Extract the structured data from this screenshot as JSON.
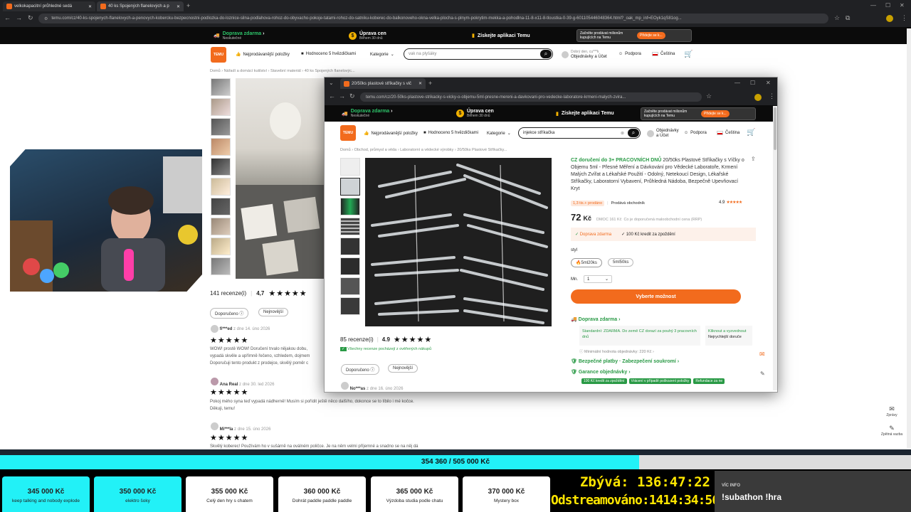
{
  "browser": {
    "tabs": [
      {
        "label": "velkokapacitní průhledné sedá"
      },
      {
        "label": "40 ks Spojených flanelových a p"
      }
    ],
    "url": "temu.com/cz/40-ks-spojenych-flanelovych-a-penovych-kobercku-bezpecnostni-podlozka-do-loznice-silna-podlahova-rohoz-do-obyvacho-pokoje-tatami-rohoz-do-satniku-koberec-do-balkonoveho-okna-velka-plocha-s-plnym-pokrytim-mekka-a-pohodlna-11-8-x11-8-tloustka-0-39-g-601105446048364.html?_oak_mp_inf=EOyk1qS81og..."
  },
  "promo": {
    "free_shipping": "Doprava zdarma",
    "free_shipping_sub": "Neskutečné",
    "price_adjust": "Úprava cen",
    "price_adjust_sub": "Během 30 dnů",
    "app": "Získejte aplikaci Temu",
    "sell_text": "Začněte prodávat milionům kupujících na Temu",
    "sell_btn": "Přidejte se k..."
  },
  "header": {
    "logo": "TEMU",
    "bestsellers": "Nejprodávanější položky",
    "five_star": "Hodnoceno 5 hvězdičkami",
    "category": "Kategorie",
    "search_value": "vak na plyšáky",
    "greeting": "Dobrý den, cu***k",
    "orders": "Objednávky a Účet",
    "support": "Podpora",
    "language": "Čeština"
  },
  "back_page": {
    "breadcrumb": [
      "Domů",
      "Nářadí a domácí kutilství",
      "Stavební materiál",
      "40 ks Spojených flanelovýc..."
    ],
    "reviews_count": "141 recenze(i)",
    "rating": "4,7",
    "stars": "★★★★★",
    "sort_recommended": "Doporučeno",
    "sort_newest": "Nejnovější",
    "reviews": [
      {
        "name": "fi***ed",
        "meta": "z  dne 14. úno 2026",
        "text1": "WOW! prostě WOW! Doručení trvalo nějakou dobu,",
        "text2": "vypadá skvěle a upřímně řečeno, vzhledem, dojmem",
        "text3": "Doporučuji tento produkt z prodejce, skvělý poměr c"
      },
      {
        "name": "Ana Real",
        "meta": "z  dne 30. led 2026",
        "text1": "Pokoj mého syna teď vypadá nádherně! Musím si pořídit ještě něco dalšího, dokonce se to líbilo i mé kočce.",
        "text2": "Děkuji, temu!"
      },
      {
        "name": "Mi***la",
        "meta": "z  dne 15. úno 2026",
        "text1": "Skvělý koberec! Používám ho v sušárně na oválném poličce. Je na něm velmi příjemné a snadno se na něj dá"
      }
    ]
  },
  "popup": {
    "tab": "20/50ks plastové stříkačky s vič",
    "url": "temu.com/cz/20-50ks-plastove-strikacky-s-vicky-o-objemu-5ml-presne-mereni-a-davkovani-pro-vedecke-laboratore-krmeni-malych-zvira...",
    "search_value": "injekce stříkačka",
    "orders": "Objednávky a Účet",
    "breadcrumb": [
      "Domů",
      "Obchod, průmysl a věda",
      "Laboratorní a vědecké výrobky",
      "20/50ks Plastové Stříkačky..."
    ],
    "title_prefix": "CZ doručení do 3+ PRACOVNÍCH DNŮ",
    "title": "20/50ks Plastové Stříkačky s Víčky o Objemu 5ml - Přesné Měření a Dávkování pro Vědecké Laboratoře, Krmení Malých Zvířat a Lékařské Použití - Odolný, Netekoucí Design, Lékařské Stříkačky, Laboratorní Vybavení, Průhledná Nádoba, Bezpečně Upevňovací Kryt",
    "sold": "1,3 tis.+ prodáno",
    "seller": "Prodává obchodník",
    "rating": "4.9",
    "price": "72",
    "currency": "Kč",
    "rrp": "DMOC 161 Kč",
    "rrp_note": "Co je doporučená maloobchodní cena (RRP)",
    "benefit1": "Doprava zdarma",
    "benefit2": "100 Kč kredit za zpoždění",
    "style_label": "styl",
    "option1": "5ml20ks",
    "option2": "5ml50ks",
    "qty_label": "Mn.",
    "qty": "1",
    "cta": "Vyberte možnost",
    "ship_title": "Doprava zdarma",
    "ship_std": "Standardní: ZDARMA. Do země CZ dorazí za pouhý 3 pracovních dnů",
    "ship_express": "Kliknout a vyzvednout",
    "ship_express2": "Nejrychlejší doruče",
    "min_order": "Minimální hodnota objednávky: 220 Kč",
    "safe_pay": "Bezpečné platby · Zabezpečení soukromí",
    "guarantee": "Garance objednávky",
    "badges": [
      "100 Kč kredit za zpoždění",
      "Vrácení v případě poškození položky",
      "Refundace za ne"
    ],
    "reviews_count": "85 recenze(i)",
    "review_rating": "4.9",
    "verified": "Všechny recenze pocházejí z ověřených nákupů",
    "sort_recommended": "Doporučeno",
    "sort_newest": "Nejnovější",
    "first_reviewer": "No***as",
    "first_meta": "z  dne 16. úno 2026"
  },
  "side_tools": {
    "news": "Zprávy",
    "share": "Zpětná vazba"
  },
  "overlay": {
    "goal_text": "354 360 / 505 000 Kč",
    "goal_progress": 0.7017,
    "goals": [
      {
        "amount": "345 000 Kč",
        "label": "keep talking and nobody explode",
        "reached": true
      },
      {
        "amount": "350 000 Kč",
        "label": "elektro šoky",
        "reached": true
      },
      {
        "amount": "355 000 Kč",
        "label": "Celý den hry s chatem",
        "reached": false
      },
      {
        "amount": "360 000 Kč",
        "label": "Dohrát paddle paddle paddle",
        "reached": false
      },
      {
        "amount": "365 000 Kč",
        "label": "Výzdoba studia podle chatu",
        "reached": false
      },
      {
        "amount": "370 000 Kč",
        "label": "Mystery box",
        "reached": false
      }
    ],
    "remaining_label": "Zbývá:",
    "remaining": "136:47:22",
    "streamed_label": "Odstreamováno:",
    "streamed": "1414:34:56",
    "info_label": "VÍC INFO",
    "info_cmd": "!subathon !hra"
  }
}
